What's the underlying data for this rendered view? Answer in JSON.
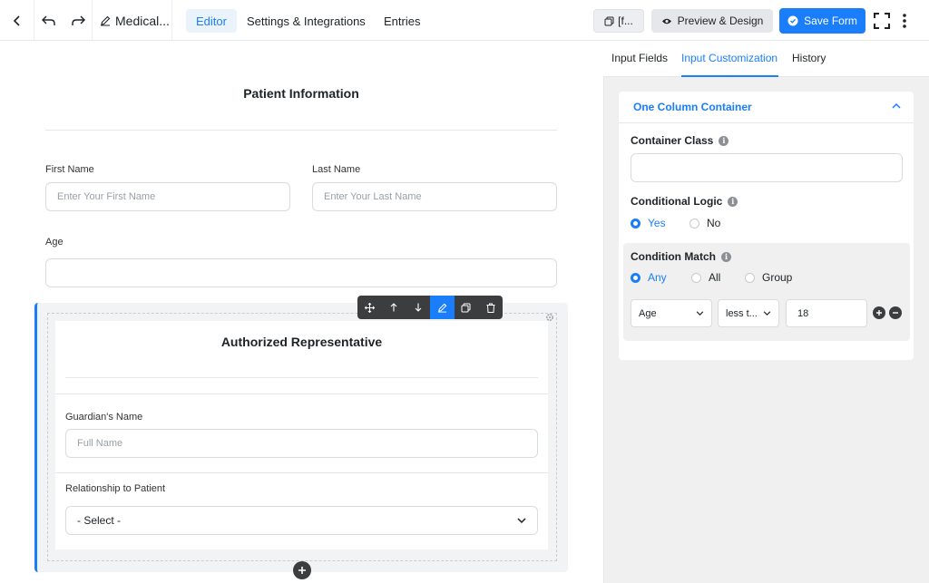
{
  "topbar": {
    "form_title": "Medical...",
    "tabs": [
      "Editor",
      "Settings & Integrations",
      "Entries"
    ],
    "shortcode_label": "[f...",
    "preview_label": "Preview & Design",
    "save_label": "Save Form"
  },
  "form": {
    "title": "Patient Information",
    "first_name_label": "First Name",
    "first_name_placeholder": "Enter Your First Name",
    "last_name_label": "Last Name",
    "last_name_placeholder": "Enter Your Last Name",
    "age_label": "Age",
    "container": {
      "title": "Authorized Representative",
      "guardian_label": "Guardian's Name",
      "guardian_placeholder": "Full Name",
      "relationship_label": "Relationship to Patient",
      "relationship_value": "- Select -"
    }
  },
  "panel": {
    "tabs": [
      "Input Fields",
      "Input Customization",
      "History"
    ],
    "section_title": "One Column Container",
    "container_class_label": "Container Class",
    "conditional_logic_label": "Conditional Logic",
    "conditional_logic_options": [
      "Yes",
      "No"
    ],
    "condition_match_label": "Condition Match",
    "condition_match_options": [
      "Any",
      "All",
      "Group"
    ],
    "rule": {
      "field": "Age",
      "operator": "less t...",
      "value": "18"
    }
  },
  "colors": {
    "accent": "#1a7efb",
    "toolbar_dark": "#3c3d3f"
  }
}
